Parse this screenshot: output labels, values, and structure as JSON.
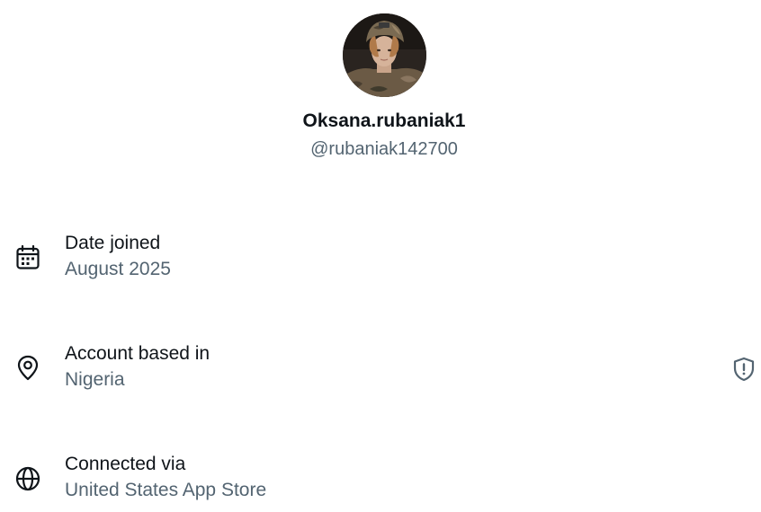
{
  "profile": {
    "display_name": "Oksana.rubaniak1",
    "handle": "@rubaniak142700",
    "avatar_icon": "profile-photo"
  },
  "details": {
    "date_joined": {
      "icon": "calendar-icon",
      "label": "Date joined",
      "value": "August 2025"
    },
    "account_based_in": {
      "icon": "location-pin-icon",
      "label": "Account based in",
      "value": "Nigeria",
      "action_icon": "shield-alert-icon"
    },
    "connected_via": {
      "icon": "globe-icon",
      "label": "Connected via",
      "value": "United States App Store"
    }
  },
  "colors": {
    "primary_text": "#0f1419",
    "secondary_text": "#536471",
    "background": "#ffffff"
  }
}
